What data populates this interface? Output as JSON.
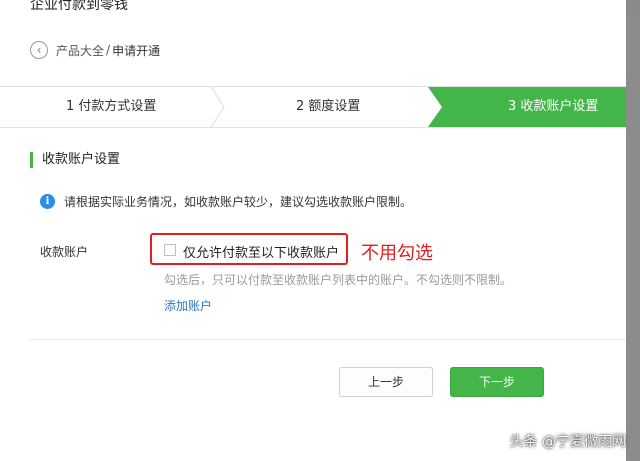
{
  "dialog": {
    "title": "企业付款到零钱"
  },
  "breadcrumb": {
    "back_icon": "chevron-left-icon",
    "parent": "产品大全",
    "separator": "/",
    "current": "申请开通"
  },
  "steps": [
    {
      "label": "1 付款方式设置",
      "active": false
    },
    {
      "label": "2 额度设置",
      "active": false
    },
    {
      "label": "3 收款账户设置",
      "active": true
    }
  ],
  "section": {
    "title": "收款账户设置",
    "info_icon": "info-icon",
    "info_text": "请根据实际业务情况，如收款账户较少，建议勾选收款账户限制。"
  },
  "form": {
    "label": "收款账户",
    "checkbox_label": "仅允许付款至以下收款账户",
    "checkbox_checked": false,
    "annotation": "不用勾选",
    "help_text": "勾选后，只可以付款至收款账户列表中的账户。不勾选则不限制。",
    "add_link": "添加账户"
  },
  "buttons": {
    "prev": "上一步",
    "next": "下一步"
  },
  "watermark": "头条 @宁夏微雨网",
  "colors": {
    "accent_green": "#44b549",
    "annotation_red": "#e02020",
    "link_blue": "#2f77c9",
    "info_blue": "#2a8de6"
  }
}
